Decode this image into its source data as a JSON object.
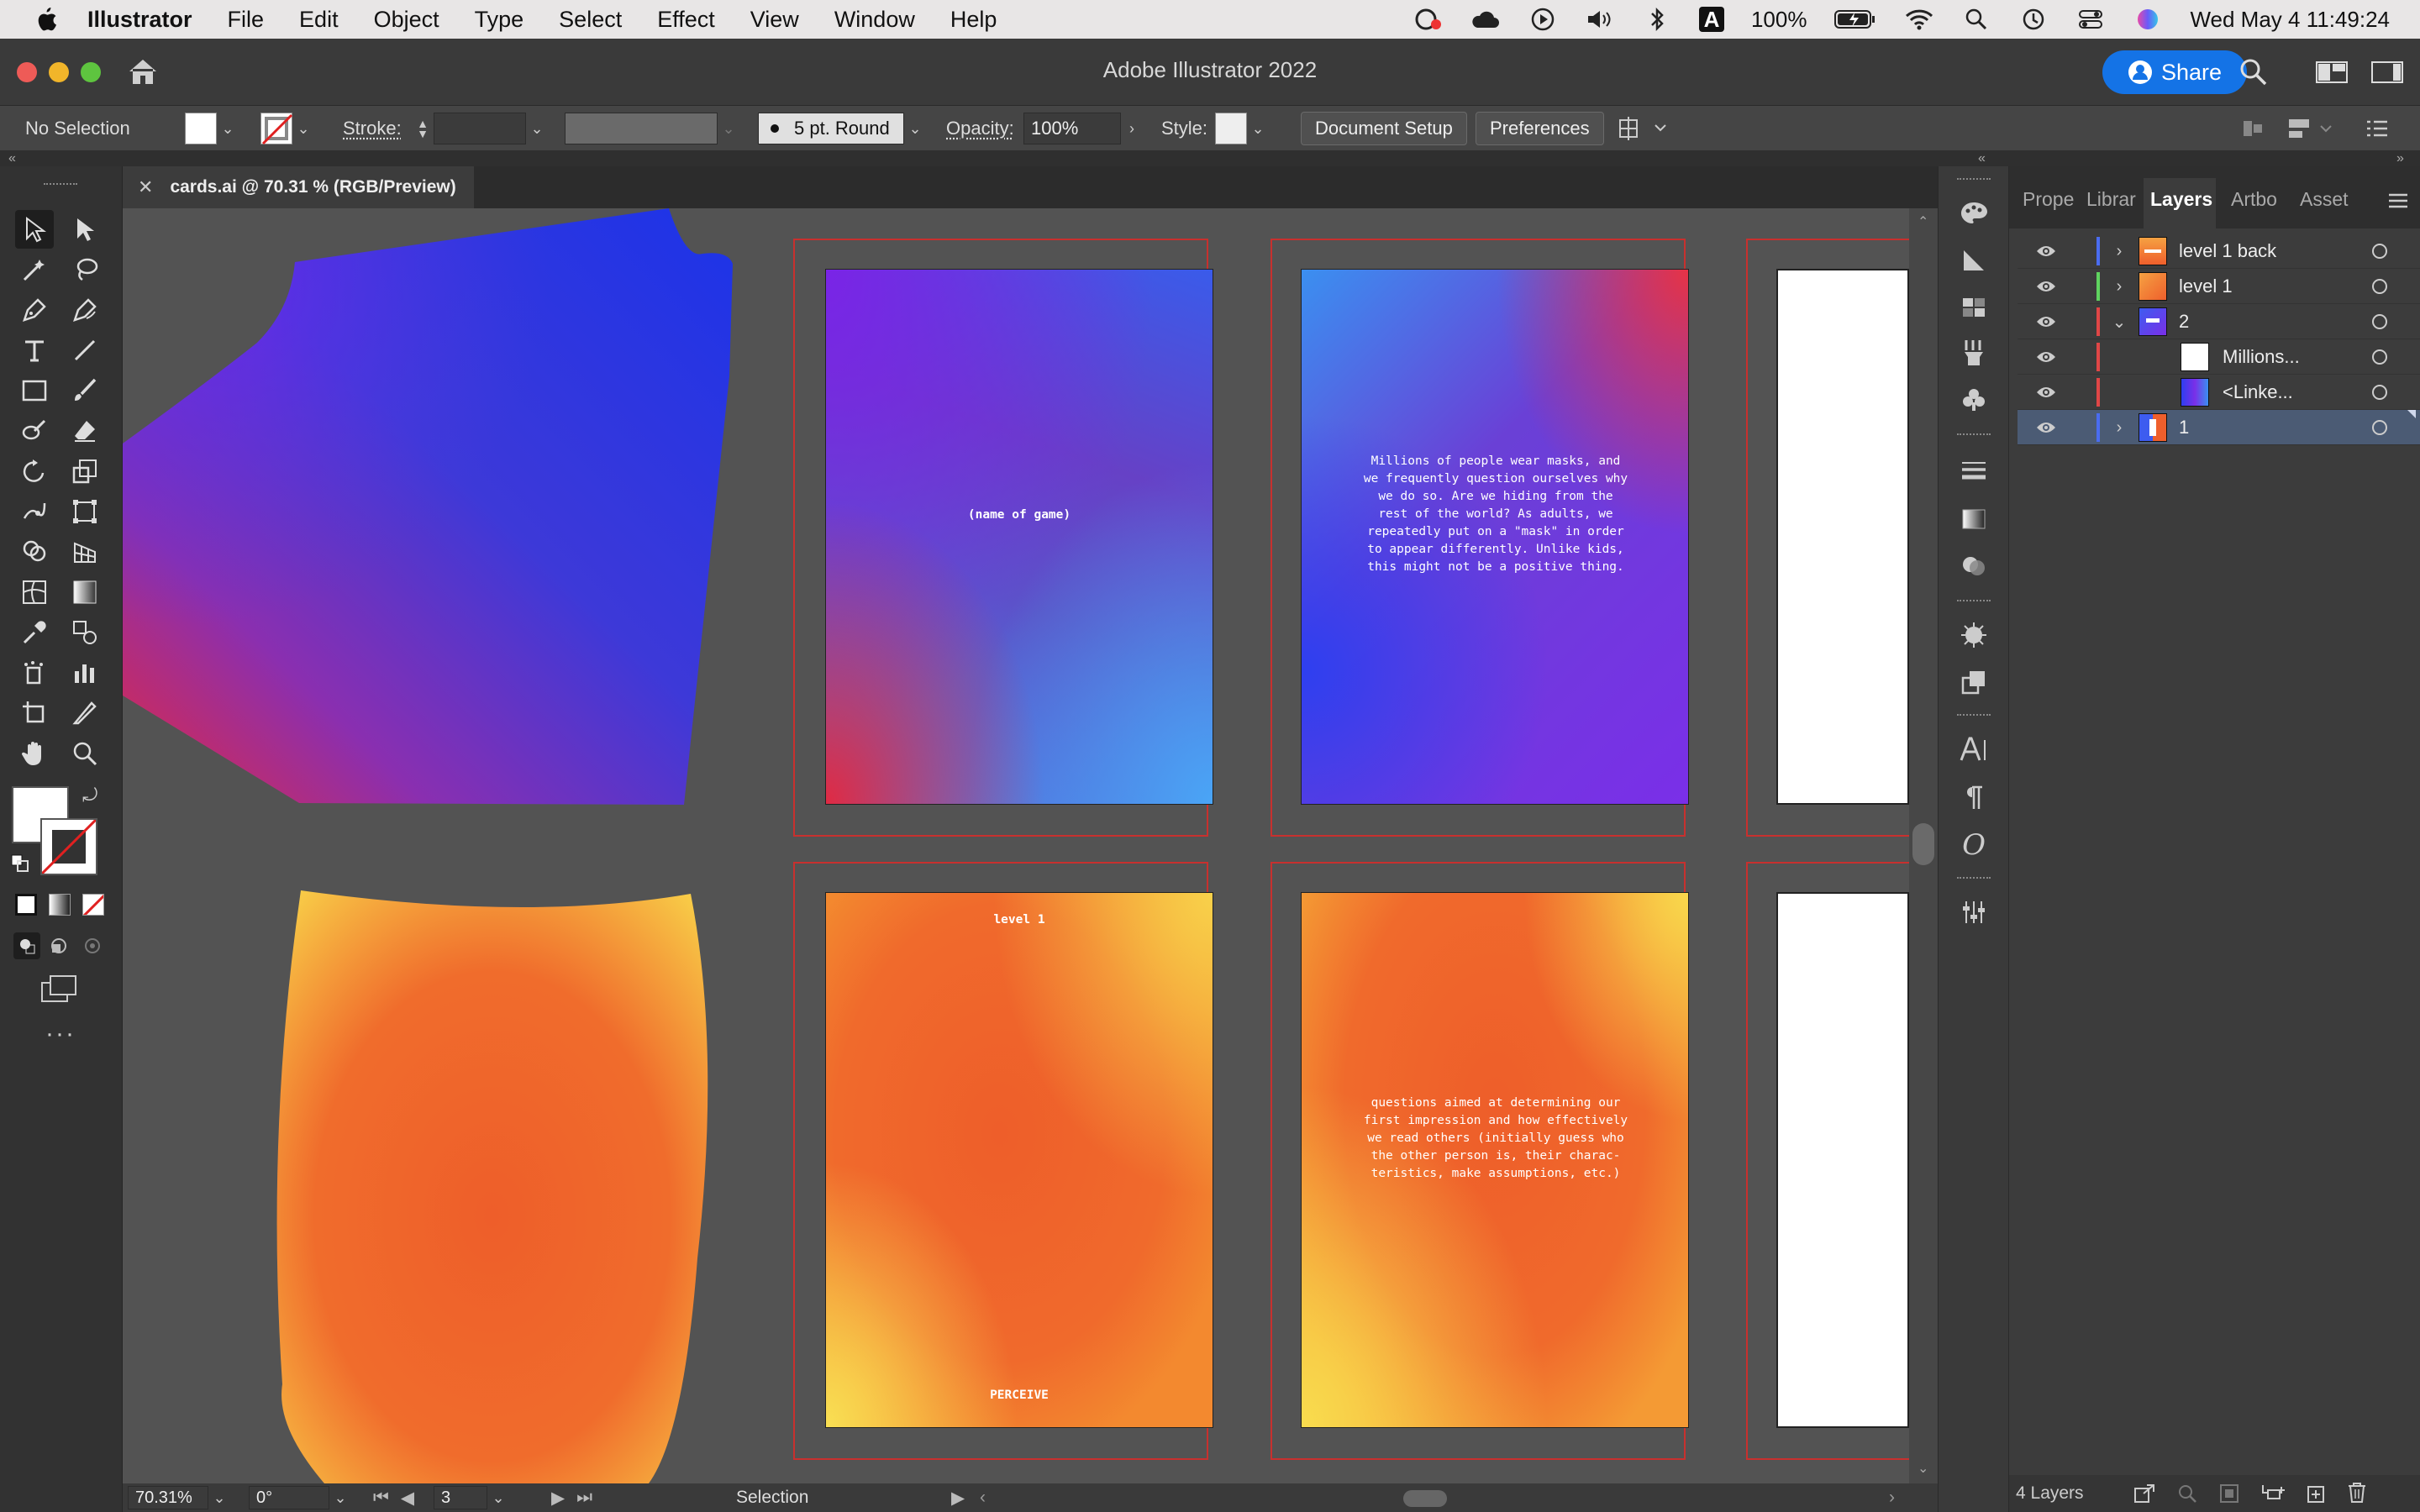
{
  "menubar": {
    "app_name": "Illustrator",
    "items": [
      "File",
      "Edit",
      "Object",
      "Type",
      "Select",
      "Effect",
      "View",
      "Window",
      "Help"
    ],
    "battery": "100%",
    "clock": "Wed May 4  11:49:24",
    "input_source": "A"
  },
  "window": {
    "title": "Adobe Illustrator 2022",
    "share_label": "Share"
  },
  "control": {
    "selection": "No Selection",
    "stroke_label": "Stroke:",
    "brush": "5 pt. Round",
    "opacity_label": "Opacity:",
    "opacity_value": "100%",
    "style_label": "Style:",
    "document_setup": "Document Setup",
    "preferences": "Preferences"
  },
  "document": {
    "tab_title": "cards.ai @ 70.31 % (RGB/Preview)",
    "cards": {
      "title_card": "(name of game)",
      "masks_text": "Millions of people wear masks, and we frequently question ourselves why we do so. Are we hiding from the rest of the world? As adults, we repeatedly put on a \"mask\" in order to appear differently. Unlike kids, this might not be a positive thing.",
      "level_card_top": "level 1",
      "level_card_bottom": "PERCEIVE",
      "questions_text": "questions aimed at determining our first impression and how effectively we read others (initially guess who the other person is, their charac-teristics, make assumptions, etc.)"
    }
  },
  "status": {
    "zoom": "70.31%",
    "rotation": "0°",
    "artboard": "3",
    "tool": "Selection"
  },
  "panel": {
    "tabs": [
      "Prope",
      "Librar",
      "Layers",
      "Artbo",
      "Asset"
    ],
    "active_tab": "Layers",
    "layers": [
      {
        "name": "level 1 back",
        "color": "#4a6cf0"
      },
      {
        "name": "level 1",
        "color": "#5fd35f"
      },
      {
        "name": "2",
        "color": "#e04646"
      },
      {
        "name": "Millions...",
        "color": "#e04646"
      },
      {
        "name": "<Linke...",
        "color": "#e04646"
      },
      {
        "name": "1",
        "color": "#4a6cf0"
      }
    ],
    "footer": "4 Layers"
  }
}
